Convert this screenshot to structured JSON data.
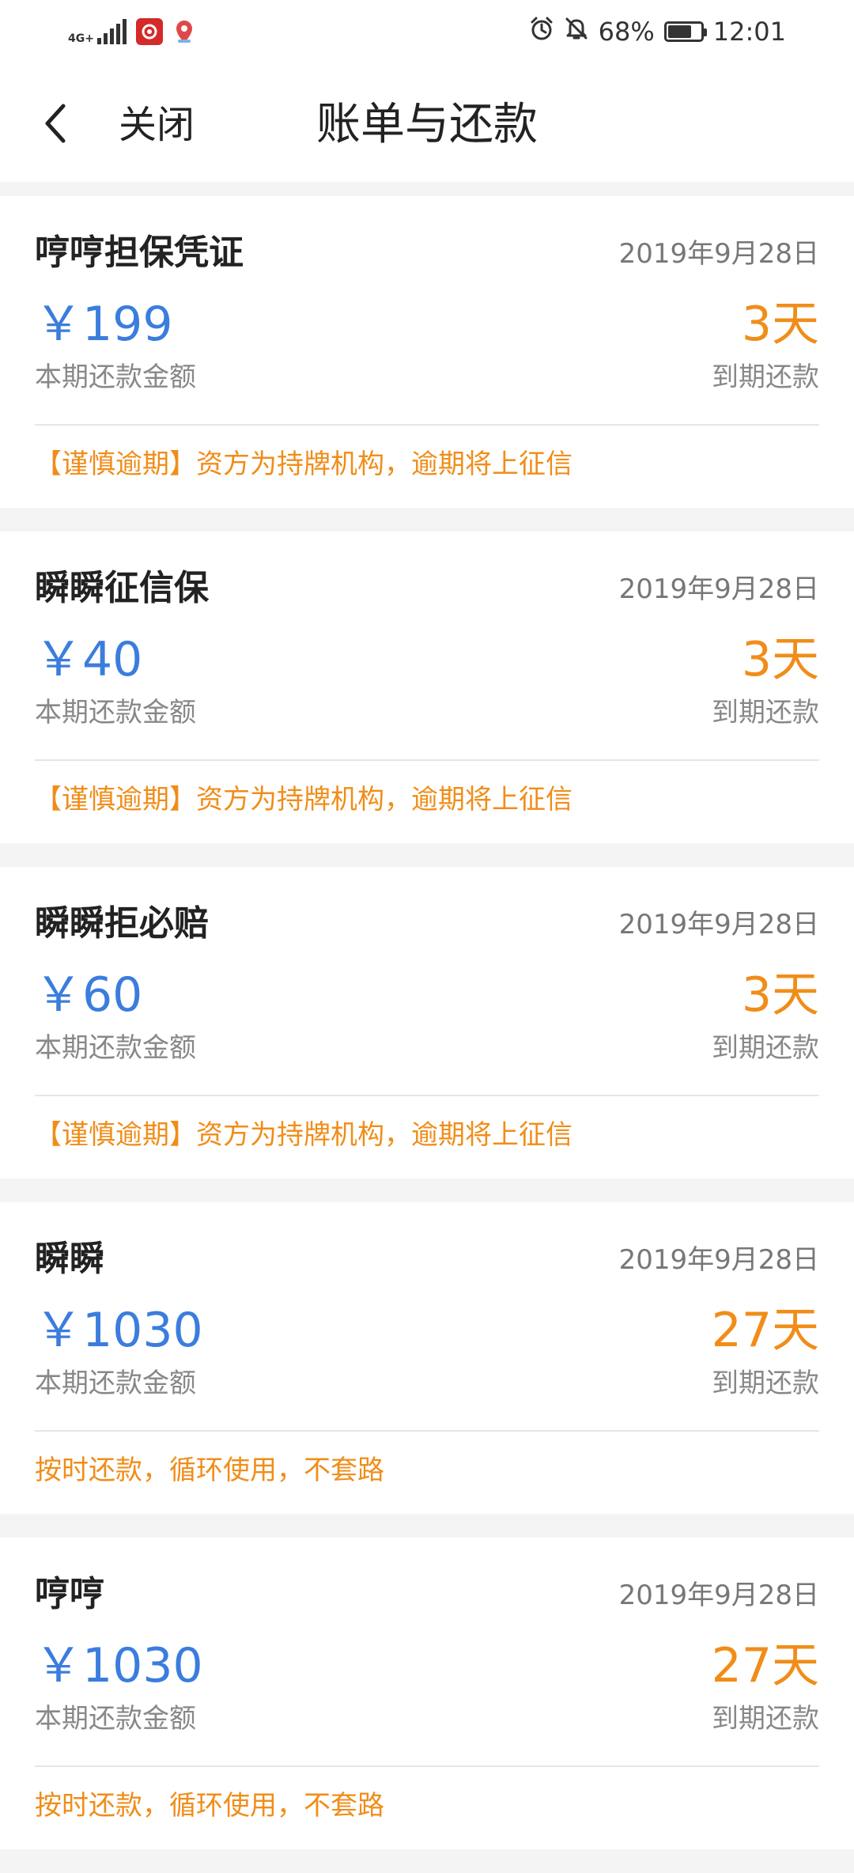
{
  "status_bar": {
    "network": "4G+",
    "battery": "68%",
    "time": "12:01",
    "icons": [
      "signal-icon",
      "app-icon-red",
      "map-pin-icon",
      "alarm-icon",
      "bell-off-icon",
      "battery-icon"
    ]
  },
  "header": {
    "back_icon": "chevron-left-icon",
    "close_label": "关闭",
    "title": "账单与还款"
  },
  "colors": {
    "amount": "#3b7ddd",
    "due": "#f08d19",
    "notice": "#f08d19"
  },
  "bills": [
    {
      "name": "哼哼担保凭证",
      "date": "2019年9月28日",
      "amount": "￥199",
      "amount_label": "本期还款金额",
      "days": "3天",
      "due_label": "到期还款",
      "notice": "【谨慎逾期】资方为持牌机构，逾期将上征信"
    },
    {
      "name": "瞬瞬征信保",
      "date": "2019年9月28日",
      "amount": "￥40",
      "amount_label": "本期还款金额",
      "days": "3天",
      "due_label": "到期还款",
      "notice": "【谨慎逾期】资方为持牌机构，逾期将上征信"
    },
    {
      "name": "瞬瞬拒必赔",
      "date": "2019年9月28日",
      "amount": "￥60",
      "amount_label": "本期还款金额",
      "days": "3天",
      "due_label": "到期还款",
      "notice": "【谨慎逾期】资方为持牌机构，逾期将上征信"
    },
    {
      "name": "瞬瞬",
      "date": "2019年9月28日",
      "amount": "￥1030",
      "amount_label": "本期还款金额",
      "days": "27天",
      "due_label": "到期还款",
      "notice": "按时还款，循环使用，不套路"
    },
    {
      "name": "哼哼",
      "date": "2019年9月28日",
      "amount": "￥1030",
      "amount_label": "本期还款金额",
      "days": "27天",
      "due_label": "到期还款",
      "notice": "按时还款，循环使用，不套路"
    }
  ]
}
